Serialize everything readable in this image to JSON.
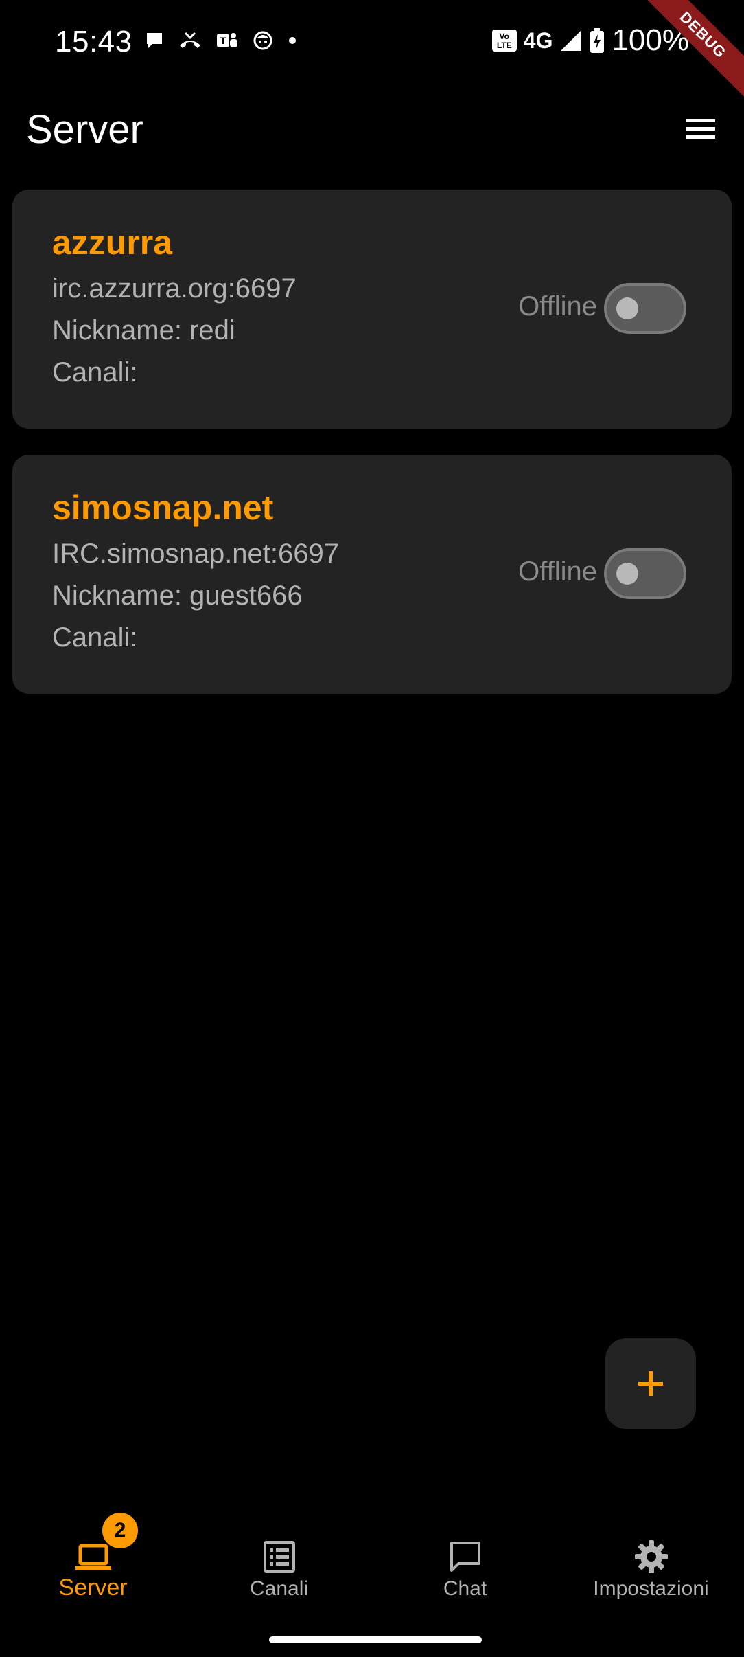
{
  "status_bar": {
    "time": "15:43",
    "network": "4G",
    "volte": "Vo LTE",
    "battery": "100%"
  },
  "debug_banner": "DEBUG",
  "app_bar": {
    "title": "Server",
    "menu_icon": "hamburger-menu-icon"
  },
  "servers": [
    {
      "name": "azzurra",
      "host": "irc.azzurra.org:6697",
      "nickname": "Nickname: redi",
      "channels": "Canali:",
      "status": "Offline",
      "connected": false
    },
    {
      "name": "simosnap.net",
      "host": "IRC.simosnap.net:6697",
      "nickname": "Nickname: guest666",
      "channels": "Canali:",
      "status": "Offline",
      "connected": false
    }
  ],
  "fab": {
    "icon": "plus-icon"
  },
  "bottom_nav": {
    "items": [
      {
        "label": "Server",
        "icon": "laptop-icon",
        "badge": "2",
        "active": true
      },
      {
        "label": "Canali",
        "icon": "list-icon",
        "active": false
      },
      {
        "label": "Chat",
        "icon": "chat-bubble-icon",
        "active": false
      },
      {
        "label": "Impostazioni",
        "icon": "gear-icon",
        "active": false
      }
    ]
  },
  "colors": {
    "accent": "#ff9a00",
    "background": "#000000",
    "card": "#232323",
    "secondary_text": "#b3b3b3",
    "debug_ribbon": "#8b1a1a"
  }
}
